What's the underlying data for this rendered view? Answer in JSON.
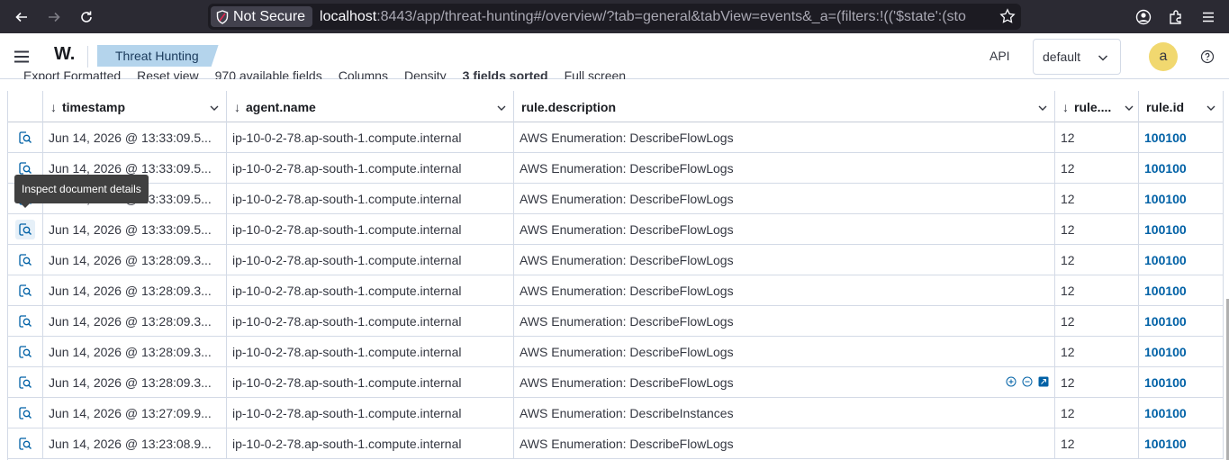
{
  "browser": {
    "security_label": "Not Secure",
    "url_host": "localhost",
    "url_rest": ":8443/app/threat-hunting#/overview/?tab=general&tabView=events&_a=(filters:!(('$state':(sto"
  },
  "header": {
    "logo_text": "W.",
    "breadcrumb": "Threat Hunting",
    "api_label": "API",
    "api_select_value": "default",
    "avatar_letter": "a"
  },
  "toolbar": {
    "items": [
      "Export Formatted",
      "Reset view",
      "970 available fields",
      "Columns",
      "Density",
      "3 fields sorted",
      "Full screen"
    ]
  },
  "grid": {
    "columns": [
      {
        "label": "timestamp"
      },
      {
        "label": "agent.name"
      },
      {
        "label": "rule.description"
      },
      {
        "label": "rule...."
      },
      {
        "label": "rule.id"
      }
    ],
    "rows": [
      {
        "timestamp": "Jun 14, 2026 @ 13:33:09.5...",
        "agent": "ip-10-0-2-78.ap-south-1.compute.internal",
        "description": "AWS Enumeration: DescribeFlowLogs",
        "level": "12",
        "rule_id": "100100"
      },
      {
        "timestamp": "Jun 14, 2026 @ 13:33:09.5...",
        "agent": "ip-10-0-2-78.ap-south-1.compute.internal",
        "description": "AWS Enumeration: DescribeFlowLogs",
        "level": "12",
        "rule_id": "100100"
      },
      {
        "timestamp": "Jun 14, 2026 @ 13:33:09.5...",
        "agent": "ip-10-0-2-78.ap-south-1.compute.internal",
        "description": "AWS Enumeration: DescribeFlowLogs",
        "level": "12",
        "rule_id": "100100"
      },
      {
        "timestamp": "Jun 14, 2026 @ 13:33:09.5...",
        "agent": "ip-10-0-2-78.ap-south-1.compute.internal",
        "description": "AWS Enumeration: DescribeFlowLogs",
        "level": "12",
        "rule_id": "100100"
      },
      {
        "timestamp": "Jun 14, 2026 @ 13:28:09.3...",
        "agent": "ip-10-0-2-78.ap-south-1.compute.internal",
        "description": "AWS Enumeration: DescribeFlowLogs",
        "level": "12",
        "rule_id": "100100"
      },
      {
        "timestamp": "Jun 14, 2026 @ 13:28:09.3...",
        "agent": "ip-10-0-2-78.ap-south-1.compute.internal",
        "description": "AWS Enumeration: DescribeFlowLogs",
        "level": "12",
        "rule_id": "100100"
      },
      {
        "timestamp": "Jun 14, 2026 @ 13:28:09.3...",
        "agent": "ip-10-0-2-78.ap-south-1.compute.internal",
        "description": "AWS Enumeration: DescribeFlowLogs",
        "level": "12",
        "rule_id": "100100"
      },
      {
        "timestamp": "Jun 14, 2026 @ 13:28:09.3...",
        "agent": "ip-10-0-2-78.ap-south-1.compute.internal",
        "description": "AWS Enumeration: DescribeFlowLogs",
        "level": "12",
        "rule_id": "100100"
      },
      {
        "timestamp": "Jun 14, 2026 @ 13:28:09.3...",
        "agent": "ip-10-0-2-78.ap-south-1.compute.internal",
        "description": "AWS Enumeration: DescribeFlowLogs",
        "level": "12",
        "rule_id": "100100"
      },
      {
        "timestamp": "Jun 14, 2026 @ 13:27:09.9...",
        "agent": "ip-10-0-2-78.ap-south-1.compute.internal",
        "description": "AWS Enumeration: DescribeInstances",
        "level": "12",
        "rule_id": "100100"
      },
      {
        "timestamp": "Jun 14, 2026 @ 13:23:08.9...",
        "agent": "ip-10-0-2-78.ap-south-1.compute.internal",
        "description": "AWS Enumeration: DescribeFlowLogs",
        "level": "12",
        "rule_id": "100100"
      }
    ]
  },
  "tooltip": {
    "text": "Inspect document details"
  },
  "colors": {
    "link": "#0061a6",
    "breadcrumb_bg": "#b4d4ec",
    "avatar_bg": "#f1d86f",
    "browser_chrome": "#2b2a33"
  }
}
